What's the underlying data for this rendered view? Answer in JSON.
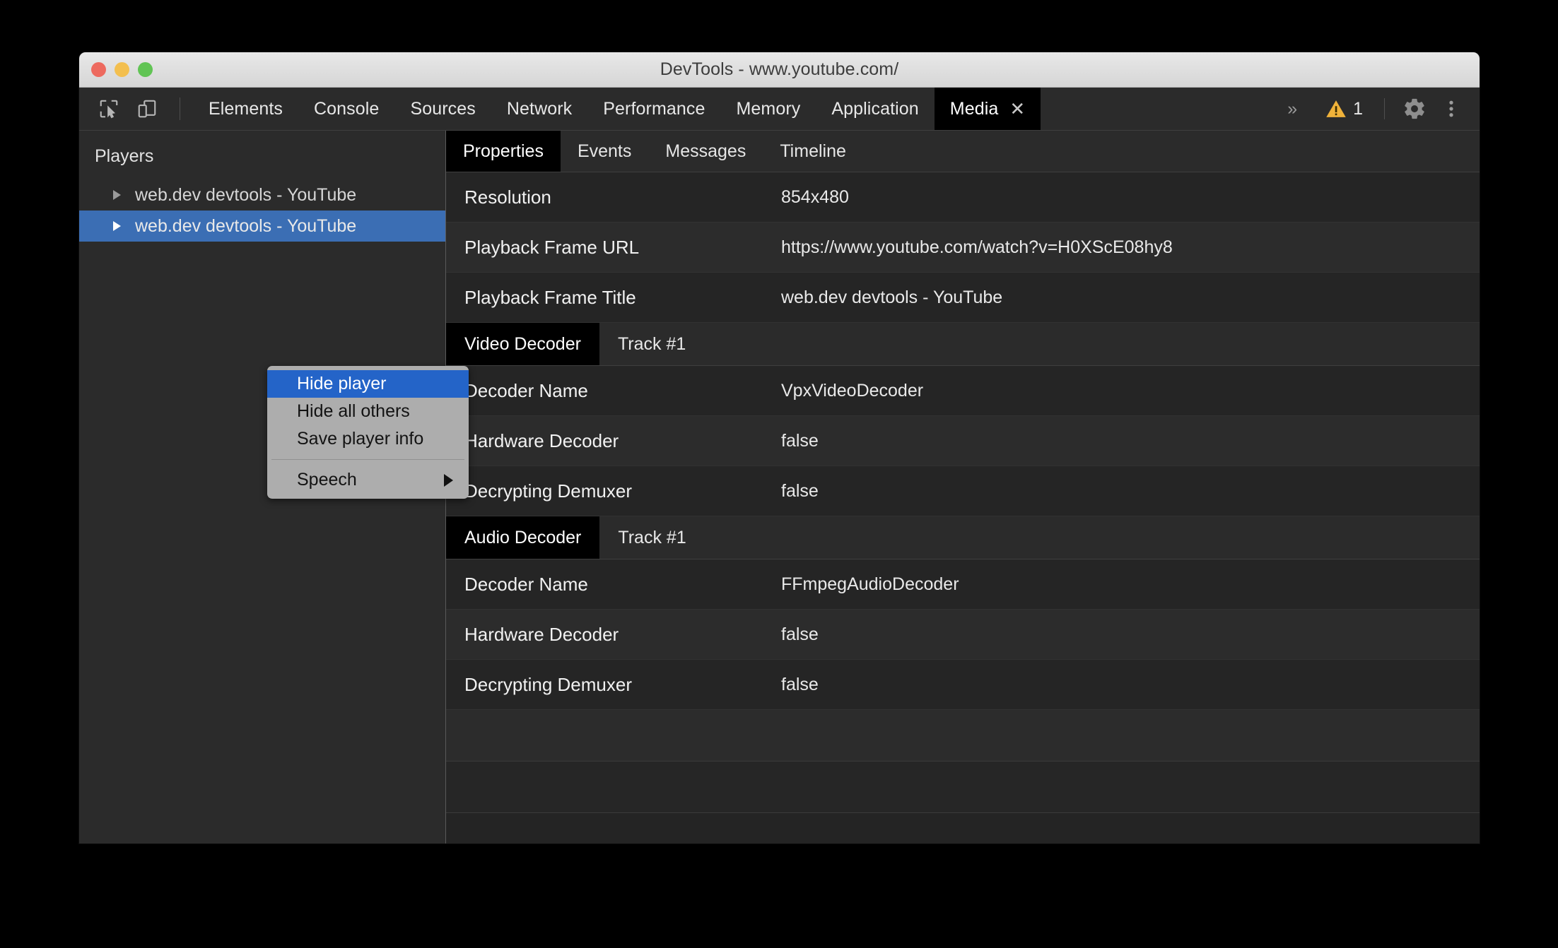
{
  "window": {
    "title": "DevTools - www.youtube.com/",
    "traffic_lights": [
      "close",
      "minimize",
      "zoom"
    ]
  },
  "toolbar": {
    "inspect_icon": "inspect-cursor-icon",
    "device_icon": "device-toolbar-icon",
    "tabs": [
      {
        "label": "Elements",
        "active": false,
        "closable": false
      },
      {
        "label": "Console",
        "active": false,
        "closable": false
      },
      {
        "label": "Sources",
        "active": false,
        "closable": false
      },
      {
        "label": "Network",
        "active": false,
        "closable": false
      },
      {
        "label": "Performance",
        "active": false,
        "closable": false
      },
      {
        "label": "Memory",
        "active": false,
        "closable": false
      },
      {
        "label": "Application",
        "active": false,
        "closable": false
      },
      {
        "label": "Media",
        "active": true,
        "closable": true
      }
    ],
    "close_glyph": "✕",
    "more_tabs_glyph": "»",
    "warning_count": "1",
    "warning_color": "#f0b23a",
    "settings_icon": "gear-icon",
    "menu_icon": "three-dots-vertical-icon"
  },
  "sidebar": {
    "title": "Players",
    "players": [
      {
        "label": "web.dev devtools - YouTube",
        "selected": false
      },
      {
        "label": "web.dev devtools - YouTube",
        "selected": true
      }
    ],
    "expander_icon": "triangle-right-icon"
  },
  "context_menu": {
    "items": [
      {
        "label": "Hide player",
        "highlight": true,
        "submenu": false
      },
      {
        "label": "Hide all others",
        "highlight": false,
        "submenu": false
      },
      {
        "label": "Save player info",
        "highlight": false,
        "submenu": false
      }
    ],
    "separator_after": 3,
    "submenu_items": [
      {
        "label": "Speech",
        "highlight": false,
        "submenu": true
      }
    ],
    "submenu_arrow_icon": "triangle-right-icon",
    "highlight_color": "#2464c8"
  },
  "content": {
    "sub_tabs": [
      {
        "label": "Properties",
        "active": true
      },
      {
        "label": "Events",
        "active": false
      },
      {
        "label": "Messages",
        "active": false
      },
      {
        "label": "Timeline",
        "active": false
      }
    ],
    "properties": [
      {
        "key": "Resolution",
        "value": "854x480"
      },
      {
        "key": "Playback Frame URL",
        "value": "https://www.youtube.com/watch?v=H0XScE08hy8"
      },
      {
        "key": "Playback Frame Title",
        "value": "web.dev devtools - YouTube"
      }
    ],
    "video_decoder": {
      "title": "Video Decoder",
      "track": "Track #1",
      "rows": [
        {
          "key": "Decoder Name",
          "value": "VpxVideoDecoder"
        },
        {
          "key": "Hardware Decoder",
          "value": "false"
        },
        {
          "key": "Decrypting Demuxer",
          "value": "false"
        }
      ]
    },
    "audio_decoder": {
      "title": "Audio Decoder",
      "track": "Track #1",
      "rows": [
        {
          "key": "Decoder Name",
          "value": "FFmpegAudioDecoder"
        },
        {
          "key": "Hardware Decoder",
          "value": "false"
        },
        {
          "key": "Decrypting Demuxer",
          "value": "false"
        }
      ]
    },
    "empty_rows": 2
  },
  "colors": {
    "panel_bg": "#242424",
    "toolbar_bg": "#2b2b2b",
    "active_tab_bg": "#000000",
    "selection_blue": "#3b6eb4",
    "menu_bg": "#adadad"
  }
}
